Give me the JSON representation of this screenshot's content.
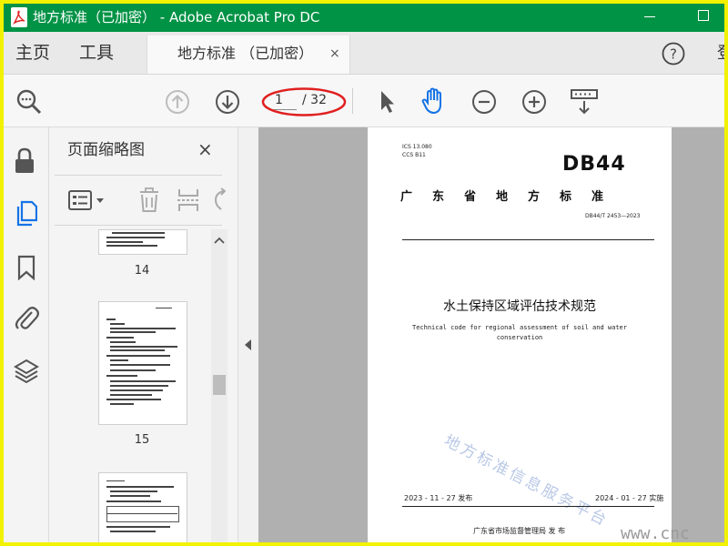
{
  "titlebar": {
    "title": "地方标准（已加密） - Adobe Acrobat Pro DC"
  },
  "menubar": {
    "home": "主页",
    "tools": "工具",
    "tab_label": "地方标准 （已加密）",
    "tab_close": "×",
    "help": "?",
    "signin_partial": "登"
  },
  "toolbar": {
    "page_current": "1",
    "page_total": "/ 32"
  },
  "thumbnails": {
    "panel_title": "页面缩略图",
    "close": "×",
    "pages": [
      "14",
      "15"
    ]
  },
  "document": {
    "ics": "ICS  13.080",
    "ccs": "CCS  B11",
    "logo": "DB44",
    "province": "广东省地方标准",
    "std_number": "DB44/T 2453—2023",
    "title_cn": "水土保持区域评估技术规范",
    "title_en_line1": "Technical code for regional assessment of soil and water",
    "title_en_line2": "conservation",
    "watermark": "地方标准信息服务平台",
    "publish_date": "2023 - 11 - 27 发布",
    "implement_date": "2024 - 01 - 27 实施",
    "issuer": "广东省市场监督管理局      发  布",
    "corner_watermark": "www.cnc"
  },
  "colors": {
    "titlebar": "#009245",
    "accent_blue": "#1473e6",
    "annotation_red": "#e02020",
    "frame": "#f2f200"
  }
}
